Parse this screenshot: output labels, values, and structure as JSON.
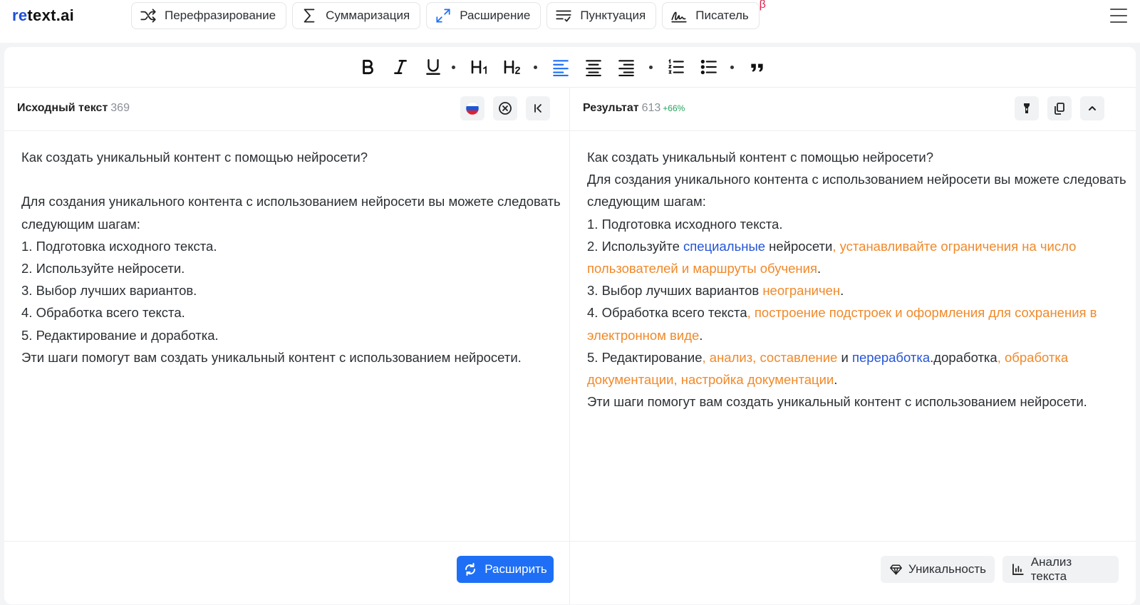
{
  "app": {
    "logo_prefix": "re",
    "logo_rest": "text.ai"
  },
  "modes": [
    {
      "label": "Перефразирование",
      "icon": "shuffle-icon"
    },
    {
      "label": "Суммаризация",
      "icon": "sigma-icon"
    },
    {
      "label": "Расширение",
      "icon": "expand-icon"
    },
    {
      "label": "Пунктуация",
      "icon": "punctuation-icon"
    },
    {
      "label": "Писатель",
      "icon": "signature-icon",
      "badge": "β"
    }
  ],
  "source": {
    "title": "Исходный текст",
    "count": "369",
    "lines": [
      "Как создать уникальный контент с помощью нейросети?",
      "",
      "Для создания уникального контента с использованием нейросети вы можете следовать следующим шагам:",
      "1. Подготовка исходного текста.",
      "2. Используйте нейросети.",
      "3. Выбор лучших вариантов.",
      "4. Обработка всего текста.",
      "5. Редактирование и доработка.",
      "Эти шаги помогут вам создать уникальный контент с использованием нейросети."
    ],
    "action_button": "Расширить"
  },
  "result": {
    "title": "Результат",
    "count": "613",
    "delta": "+66%",
    "l1": "Как создать уникальный контент с помощью нейросети?",
    "l2": "Для создания уникального контента с использованием нейросети вы можете следовать следующим шагам:",
    "l3": "1. Подготовка исходного текста.",
    "l4a": "2. Используйте ",
    "l4b": "специальные",
    "l4c": " нейросети",
    "l4d": ", устанавливайте ограничения на число пользователей и маршруты обучения",
    "l4e": ".",
    "l5a": "3. Выбор лучших вариантов ",
    "l5b": "неограничен",
    "l5c": ".",
    "l6a": "4. Обработка всего текста",
    "l6b": ", построение подстроек и оформления для сохранения в электронном виде",
    "l6c": ".",
    "l7a": "5. Редактирование",
    "l7b": ", анализ, составление",
    "l7c": " и ",
    "l7d": "переработка",
    "l7e": ".доработка",
    "l7f": ", обработка документации, настройка документации",
    "l7g": ".",
    "l8": "Эти шаги помогут вам создать уникальный контент с использованием нейросети.",
    "buttons": {
      "uniqueness": "Уникальность",
      "analysis": "Анализ текста"
    }
  },
  "colors": {
    "accent": "#1e6ff5",
    "insert_blue": "#2454d6",
    "insert_orange": "#f0892a",
    "delta_green": "#22a55b"
  }
}
